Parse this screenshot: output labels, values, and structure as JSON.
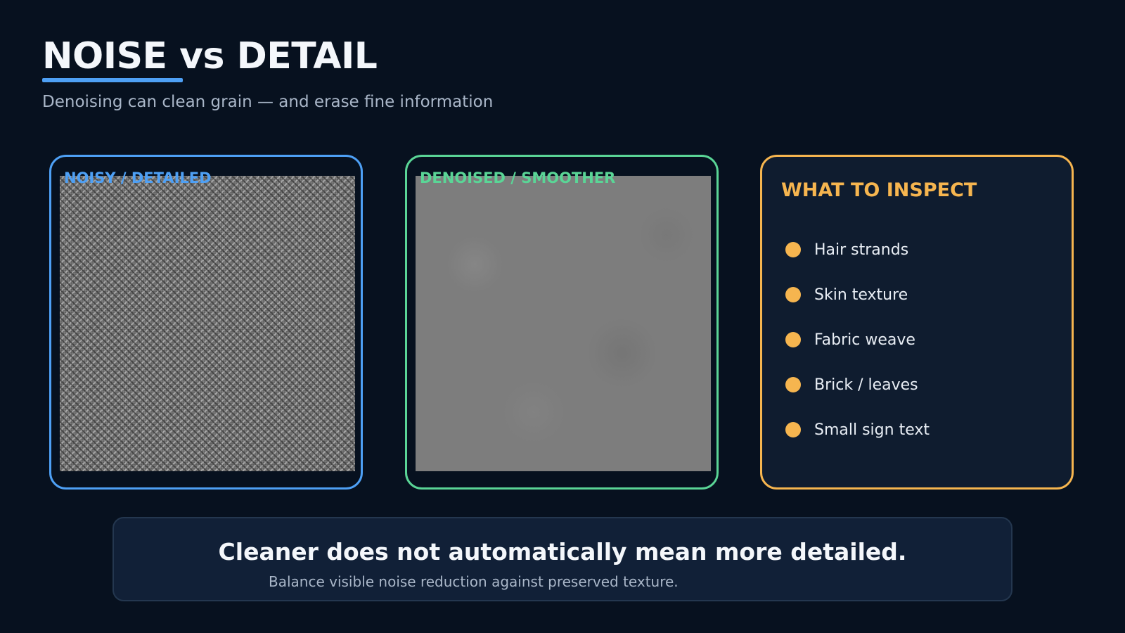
{
  "header": {
    "title": "NOISE vs DETAIL",
    "subtitle": "Denoising can clean grain — and erase fine information"
  },
  "panels": {
    "noisy": {
      "label": "NOISY / DETAILED",
      "accent": "#4ea0f5"
    },
    "denoised": {
      "label": "DENOISED / SMOOTHER",
      "accent": "#5ad596"
    },
    "inspect": {
      "title": "WHAT TO INSPECT",
      "accent": "#f6b54f",
      "items": [
        "Hair strands",
        "Skin texture",
        "Fabric weave",
        "Brick / leaves",
        "Small sign text"
      ]
    }
  },
  "callout": {
    "main": "Cleaner does not automatically mean more detailed.",
    "sub": "Balance visible noise reduction against preserved texture."
  }
}
